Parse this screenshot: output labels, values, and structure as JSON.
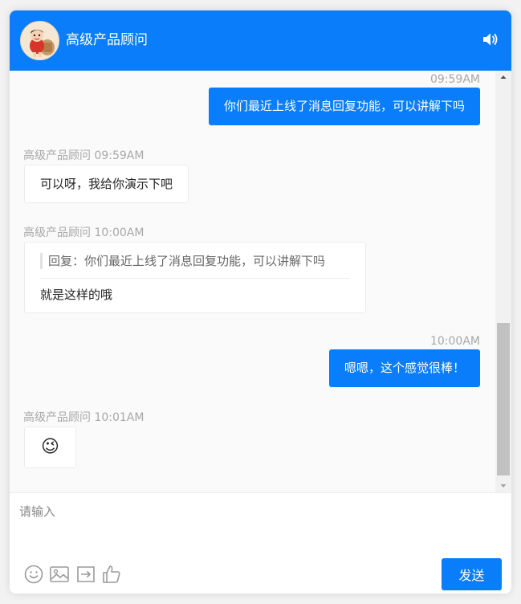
{
  "header": {
    "title": "高级产品顾问",
    "volume_icon": "volume-icon",
    "avatar_icon": "cartoon-avatar"
  },
  "messages": [
    {
      "side": "out",
      "time": "09:59AM",
      "text": "你们最近上线了消息回复功能，可以讲解下吗"
    },
    {
      "side": "in",
      "sender": "高级产品顾问",
      "time": "09:59AM",
      "sender_time": "高级产品顾问 09:59AM",
      "text": "可以呀，我给你演示下吧"
    },
    {
      "side": "in",
      "sender": "高级产品顾问",
      "time": "10:00AM",
      "sender_time": "高级产品顾问 10:00AM",
      "quote": "回复：你们最近上线了消息回复功能，可以讲解下吗",
      "text": "就是这样的哦"
    },
    {
      "side": "out",
      "time": "10:00AM",
      "text": "嗯嗯，这个感觉很棒！"
    },
    {
      "side": "in",
      "sender": "高级产品顾问",
      "time": "10:01AM",
      "sender_time": "高级产品顾问 10:01AM",
      "emoji": "😉",
      "emoji_icon": "wink-emoji-icon"
    }
  ],
  "composer": {
    "placeholder": "请输入",
    "value": "",
    "send_label": "发送",
    "tools": [
      "emoji-icon",
      "image-icon",
      "file-transfer-icon",
      "thumbs-up-icon"
    ]
  },
  "colors": {
    "brand": "#0a7dfa",
    "meta_text": "#a8a8a8",
    "bubble_in_bg": "#ffffff"
  }
}
